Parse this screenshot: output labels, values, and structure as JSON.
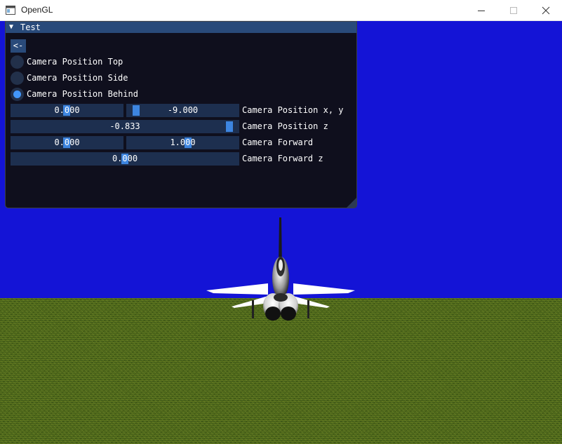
{
  "window": {
    "title": "OpenGL",
    "minimize_icon": "minimize-icon",
    "maximize_icon": "maximize-icon",
    "close_icon": "close-icon"
  },
  "scene": {
    "sky_color": "#1414d6",
    "ground_color": "#4f6b1d",
    "object": "jet-aircraft-rear-view"
  },
  "panel": {
    "title": "Test",
    "collapse_icon": "triangle-down-icon",
    "back_button": "<-",
    "radios": [
      {
        "label": "Camera Position Top",
        "selected": false
      },
      {
        "label": "Camera Position Side",
        "selected": false
      },
      {
        "label": "Camera Position Behind",
        "selected": true
      }
    ],
    "controls": [
      {
        "label": "Camera Position x, y",
        "values": [
          "0.000",
          "-9.000"
        ]
      },
      {
        "label": "Camera Position z",
        "values": [
          "-0.833"
        ]
      },
      {
        "label": "Camera Forward",
        "values": [
          "0.000",
          "1.000"
        ]
      },
      {
        "label": "Camera Forward z",
        "values": [
          "0.000"
        ]
      }
    ],
    "accent_color": "#4296fa",
    "frame_color": "#1d2f4f"
  }
}
